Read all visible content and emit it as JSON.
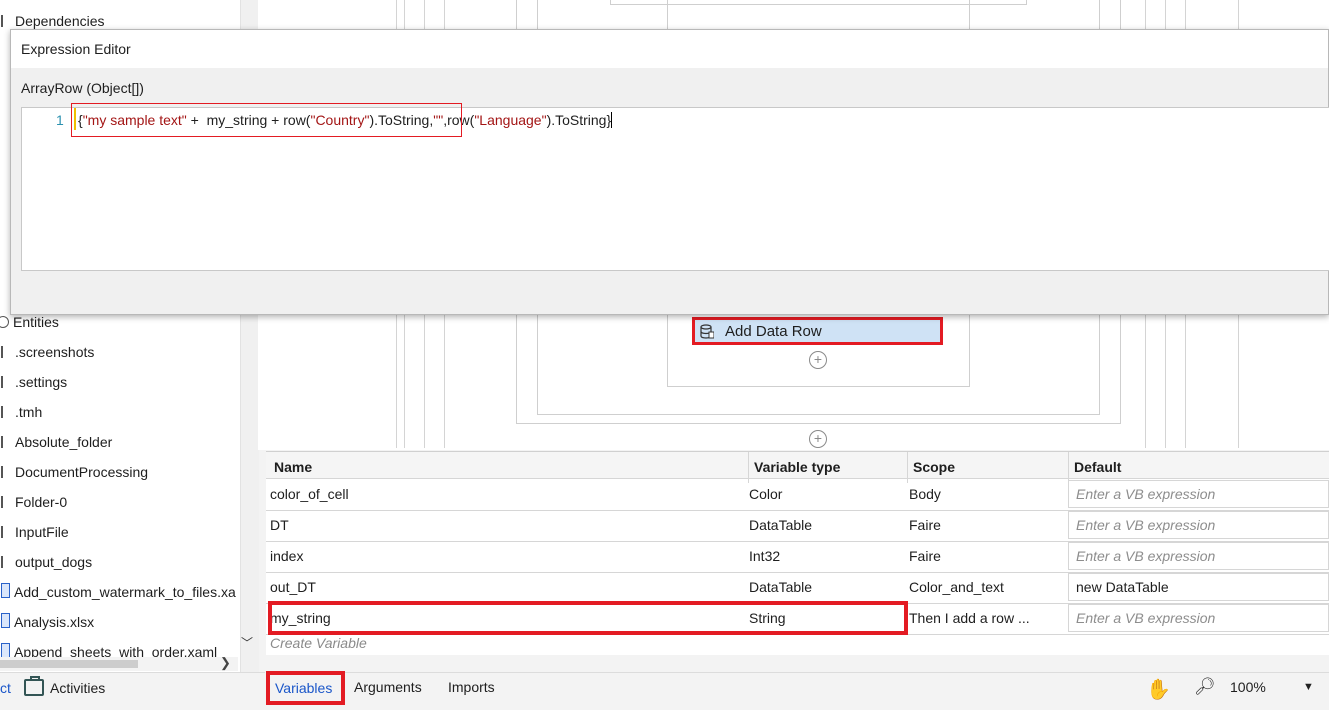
{
  "project_tree": {
    "items": [
      {
        "label": "Dependencies",
        "kind": "folder"
      },
      {
        "label": "Entities",
        "kind": "db"
      },
      {
        "label": ".screenshots",
        "kind": "folder"
      },
      {
        "label": ".settings",
        "kind": "folder"
      },
      {
        "label": ".tmh",
        "kind": "folder"
      },
      {
        "label": "Absolute_folder",
        "kind": "folder"
      },
      {
        "label": "DocumentProcessing",
        "kind": "folder"
      },
      {
        "label": "Folder-0",
        "kind": "folder"
      },
      {
        "label": "InputFile",
        "kind": "folder"
      },
      {
        "label": "output_dogs",
        "kind": "folder"
      },
      {
        "label": "Add_custom_watermark_to_files.xa",
        "kind": "file"
      },
      {
        "label": "Analysis.xlsx",
        "kind": "file"
      },
      {
        "label": "Append_sheets_with_order.xaml",
        "kind": "file"
      }
    ]
  },
  "left_tabs": {
    "project_fragment": "ct",
    "activities": "Activities"
  },
  "expression_editor": {
    "title": "Expression Editor",
    "target": "ArrayRow (Object[])",
    "line_number": "1",
    "code_parts": [
      {
        "t": "{",
        "s": false
      },
      {
        "t": "\"my sample text\"",
        "s": true
      },
      {
        "t": " +  my_string + row(",
        "s": false
      },
      {
        "t": "\"Country\"",
        "s": true
      },
      {
        "t": ").ToString,",
        "s": false
      },
      {
        "t": "\"\"",
        "s": true
      },
      {
        "t": ",row(",
        "s": false
      },
      {
        "t": "\"Language\"",
        "s": true
      },
      {
        "t": ").ToString}",
        "s": false
      }
    ]
  },
  "designer": {
    "activity_label": "Add Data Row"
  },
  "variables": {
    "headers": {
      "name": "Name",
      "type": "Variable type",
      "scope": "Scope",
      "default": "Default"
    },
    "rows": [
      {
        "name": "color_of_cell",
        "type": "Color",
        "scope": "Body",
        "default": "Enter a VB expression",
        "placeholder": true
      },
      {
        "name": "DT",
        "type": "DataTable",
        "scope": "Faire",
        "default": "Enter a VB expression",
        "placeholder": true
      },
      {
        "name": "index",
        "type": "Int32",
        "scope": "Faire",
        "default": "Enter a VB expression",
        "placeholder": true
      },
      {
        "name": "out_DT",
        "type": "DataTable",
        "scope": "Color_and_text",
        "default": "new DataTable",
        "placeholder": false
      },
      {
        "name": "my_string",
        "type": "String",
        "scope": "Then I add a row ...",
        "default": "Enter a VB expression",
        "placeholder": true
      }
    ],
    "create_label": "Create Variable"
  },
  "bottom_bar": {
    "tabs": {
      "variables": "Variables",
      "arguments": "Arguments",
      "imports": "Imports"
    },
    "zoom": "100%"
  },
  "colors": {
    "highlight": "#e31b23",
    "accent": "#1a56c9",
    "string": "#a31515",
    "selection": "#cfe2f5"
  }
}
